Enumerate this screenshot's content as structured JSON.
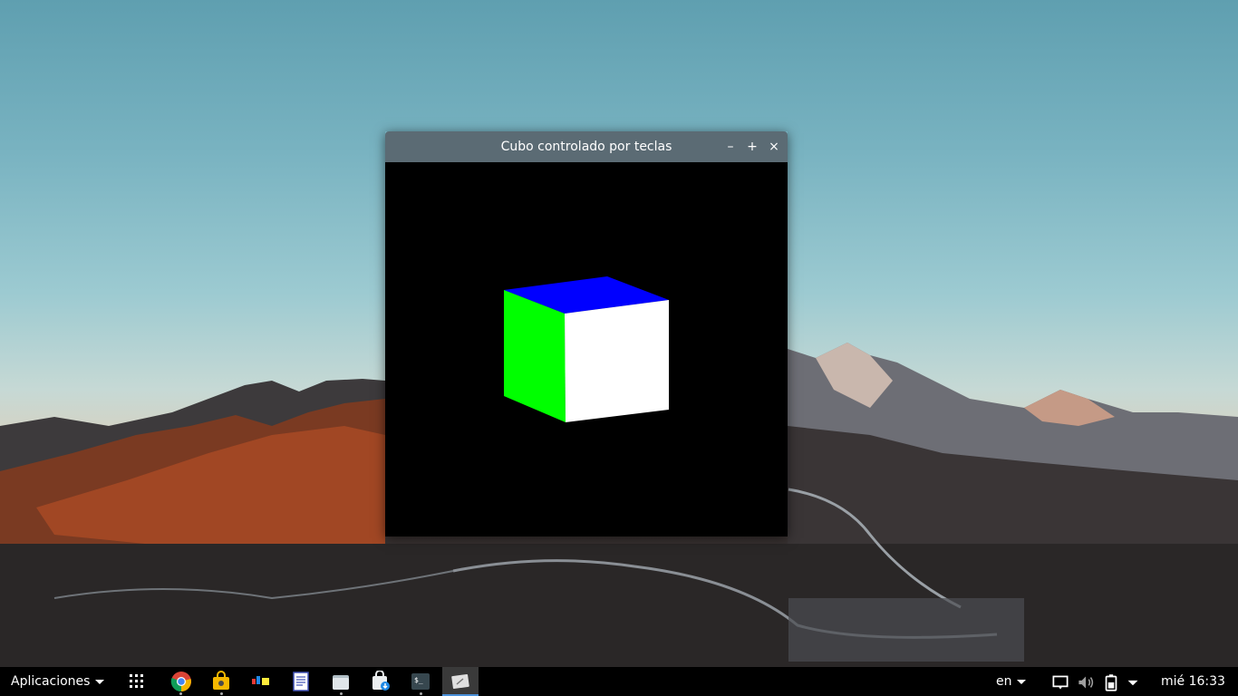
{
  "window": {
    "title": "Cubo controlado por teclas",
    "minimize_label": "–",
    "maximize_label": "+",
    "close_label": "×"
  },
  "cube": {
    "top_color": "#0000ff",
    "left_color": "#00ff00",
    "front_color": "#ffffff",
    "background_color": "#000000"
  },
  "taskbar": {
    "apps_menu_label": "Aplicaciones",
    "icons": [
      "app-grid-icon",
      "chrome-icon",
      "software-store-icon",
      "color-palette-icon",
      "text-editor-icon",
      "files-icon",
      "installer-icon",
      "terminal-icon",
      "screenshot-icon"
    ],
    "language": "en",
    "tray_icons": [
      "notifications-icon",
      "volume-icon",
      "battery-icon",
      "system-menu-icon"
    ],
    "clock": "mié 16:33"
  }
}
